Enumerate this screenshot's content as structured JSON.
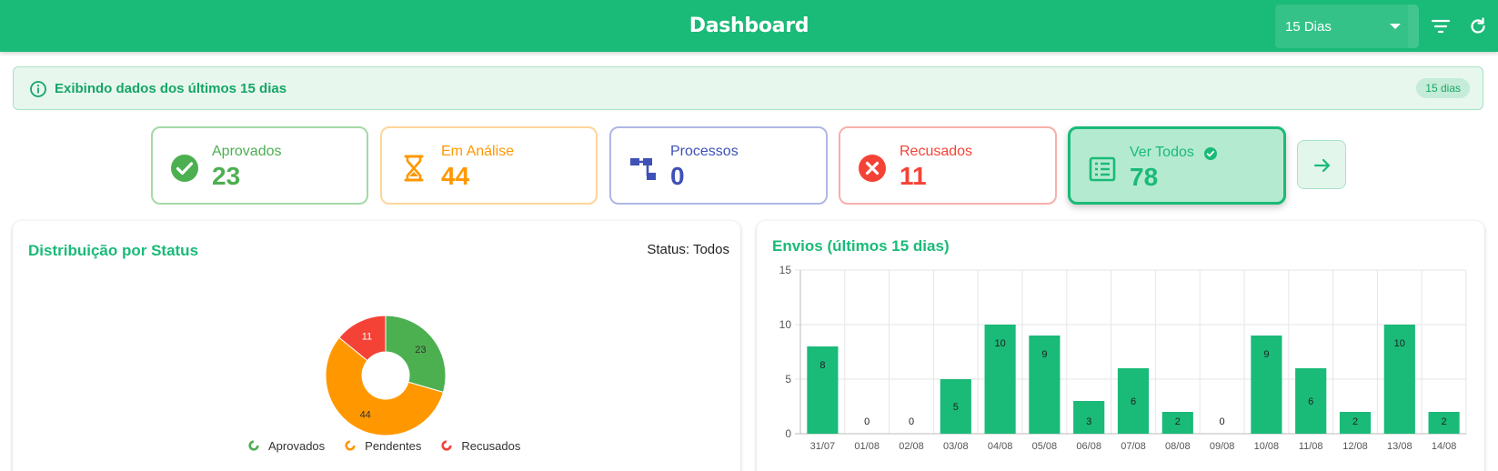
{
  "header": {
    "title": "Dashboard",
    "period_value": "15 Dias"
  },
  "info": {
    "text": "Exibindo dados dos últimos 15 dias",
    "badge": "15 dias"
  },
  "cards": [
    {
      "label": "Aprovados",
      "value": "23",
      "color": "#4caf50",
      "icon": "check-circle-icon"
    },
    {
      "label": "Em Análise",
      "value": "44",
      "color": "#ff9800",
      "icon": "hourglass-icon"
    },
    {
      "label": "Processos",
      "value": "0",
      "color": "#3f51b5",
      "icon": "workflow-icon"
    },
    {
      "label": "Recusados",
      "value": "11",
      "color": "#f44336",
      "icon": "cancel-circle-icon"
    },
    {
      "label": "Ver Todos",
      "value": "78",
      "color": "#1aba78",
      "icon": "list-icon",
      "selected": true
    }
  ],
  "status_panel": {
    "title": "Distribuição por Status",
    "status_text": "Status: Todos"
  },
  "envios_panel": {
    "title": "Envios (últimos 15 dias)"
  },
  "chart_data": [
    {
      "type": "pie",
      "variant": "donut",
      "labels": [
        "Aprovados",
        "Pendentes",
        "Recusados"
      ],
      "values": [
        23,
        44,
        11
      ],
      "colors": [
        "#4caf50",
        "#ff9800",
        "#f44336"
      ],
      "legend": "bottom"
    },
    {
      "type": "bar",
      "categories": [
        "31/07",
        "01/08",
        "02/08",
        "03/08",
        "04/08",
        "05/08",
        "06/08",
        "07/08",
        "08/08",
        "09/08",
        "10/08",
        "11/08",
        "12/08",
        "13/08",
        "14/08"
      ],
      "values": [
        8,
        0,
        0,
        5,
        10,
        9,
        3,
        6,
        2,
        0,
        9,
        6,
        2,
        10,
        2
      ],
      "ylim": [
        0,
        15
      ],
      "yticks": [
        0,
        5,
        10,
        15
      ],
      "color": "#1aba78",
      "grid": true
    }
  ]
}
